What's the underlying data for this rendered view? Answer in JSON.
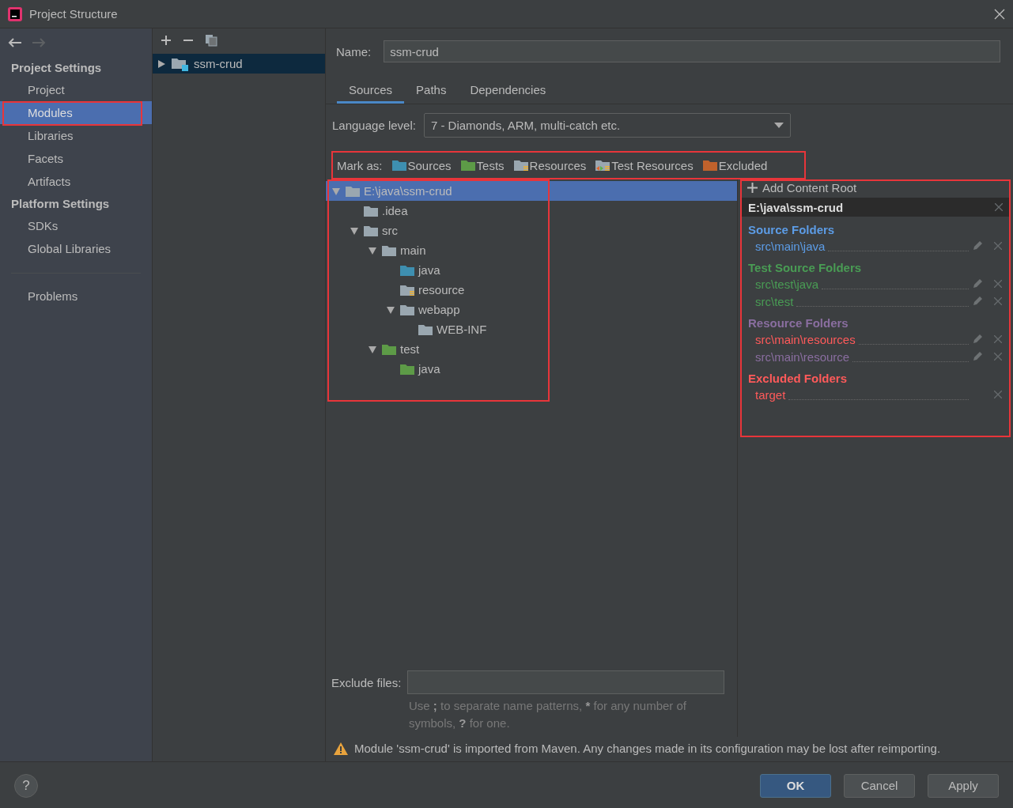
{
  "window": {
    "title": "Project Structure"
  },
  "sidebar": {
    "groups": [
      {
        "title": "Project Settings",
        "items": [
          {
            "label": "Project",
            "selected": false,
            "annotated": false
          },
          {
            "label": "Modules",
            "selected": true,
            "annotated": true
          },
          {
            "label": "Libraries",
            "selected": false,
            "annotated": false
          },
          {
            "label": "Facets",
            "selected": false,
            "annotated": false
          },
          {
            "label": "Artifacts",
            "selected": false,
            "annotated": false
          }
        ]
      },
      {
        "title": "Platform Settings",
        "items": [
          {
            "label": "SDKs",
            "selected": false,
            "annotated": false
          },
          {
            "label": "Global Libraries",
            "selected": false,
            "annotated": false
          }
        ]
      }
    ],
    "extra_items": [
      {
        "label": "Problems",
        "selected": false,
        "annotated": false
      }
    ]
  },
  "modules": {
    "items": [
      {
        "label": "ssm-crud",
        "selected": true,
        "expanded": false
      }
    ]
  },
  "name_field": {
    "label": "Name:",
    "value": "ssm-crud"
  },
  "tabs": [
    {
      "label": "Sources",
      "selected": true
    },
    {
      "label": "Paths",
      "selected": false
    },
    {
      "label": "Dependencies",
      "selected": false
    }
  ],
  "language_level": {
    "label": "Language level:",
    "value": "7 - Diamonds, ARM, multi-catch etc."
  },
  "mark_as": {
    "label": "Mark as:",
    "annotated": true,
    "options": [
      {
        "label": "Sources",
        "kind": "sources"
      },
      {
        "label": "Tests",
        "kind": "tests"
      },
      {
        "label": "Resources",
        "kind": "resources"
      },
      {
        "label": "Test Resources",
        "kind": "test_resources"
      },
      {
        "label": "Excluded",
        "kind": "excluded"
      }
    ]
  },
  "tree": {
    "annotated": true,
    "items": [
      {
        "label": "E:\\java\\ssm-crud",
        "kind": "plain",
        "selected": true,
        "expanded": true,
        "children": [
          {
            "label": ".idea",
            "kind": "plain",
            "selected": false
          },
          {
            "label": "src",
            "kind": "plain",
            "selected": false,
            "expanded": true,
            "children": [
              {
                "label": "main",
                "kind": "plain",
                "selected": false,
                "expanded": true,
                "children": [
                  {
                    "label": "java",
                    "kind": "sources",
                    "selected": false
                  },
                  {
                    "label": "resource",
                    "kind": "resources",
                    "selected": false
                  },
                  {
                    "label": "webapp",
                    "kind": "plain",
                    "selected": false,
                    "expanded": true,
                    "children": [
                      {
                        "label": "WEB-INF",
                        "kind": "plain",
                        "selected": false
                      }
                    ]
                  }
                ]
              },
              {
                "label": "test",
                "kind": "tests",
                "selected": false,
                "expanded": true,
                "children": [
                  {
                    "label": "java",
                    "kind": "tests",
                    "selected": false
                  }
                ]
              }
            ]
          }
        ]
      }
    ]
  },
  "content_root": {
    "annotated": true,
    "add_label": "Add Content Root",
    "path": "E:\\java\\ssm-crud",
    "groups": [
      {
        "title": "Source Folders",
        "color": "#5c9ce6",
        "folders": [
          {
            "path": "src\\main\\java",
            "color": "#5c9ce6",
            "editable": true
          }
        ]
      },
      {
        "title": "Test Source Folders",
        "color": "#499c54",
        "folders": [
          {
            "path": "src\\test\\java",
            "color": "#499c54",
            "editable": true
          },
          {
            "path": "src\\test",
            "color": "#499c54",
            "editable": true
          }
        ]
      },
      {
        "title": "Resource Folders",
        "color": "#8a6ea0",
        "folders": [
          {
            "path": "src\\main\\resources",
            "color": "#ff5a5a",
            "editable": true
          },
          {
            "path": "src\\main\\resource",
            "color": "#8a6ea0",
            "editable": true
          }
        ]
      },
      {
        "title": "Excluded Folders",
        "color": "#ff5a5a",
        "folders": [
          {
            "path": "target",
            "color": "#ff5a5a",
            "editable": false
          }
        ]
      }
    ]
  },
  "exclude_files": {
    "label": "Exclude files:",
    "hint": [
      {
        "text": "Use ",
        "bold": false
      },
      {
        "text": ";",
        "bold": true
      },
      {
        "text": " to separate name patterns, ",
        "bold": false
      },
      {
        "text": "*",
        "bold": true
      },
      {
        "text": " for any number of symbols, ",
        "bold": false
      },
      {
        "text": "?",
        "bold": true
      },
      {
        "text": " for one.",
        "bold": false
      }
    ]
  },
  "warning": "Module 'ssm-crud' is imported from Maven. Any changes made in its configuration may be lost after reimporting.",
  "help_button": "?",
  "buttons": [
    {
      "label": "OK",
      "default": true
    },
    {
      "label": "Cancel",
      "default": false
    },
    {
      "label": "Apply",
      "default": false
    }
  ]
}
